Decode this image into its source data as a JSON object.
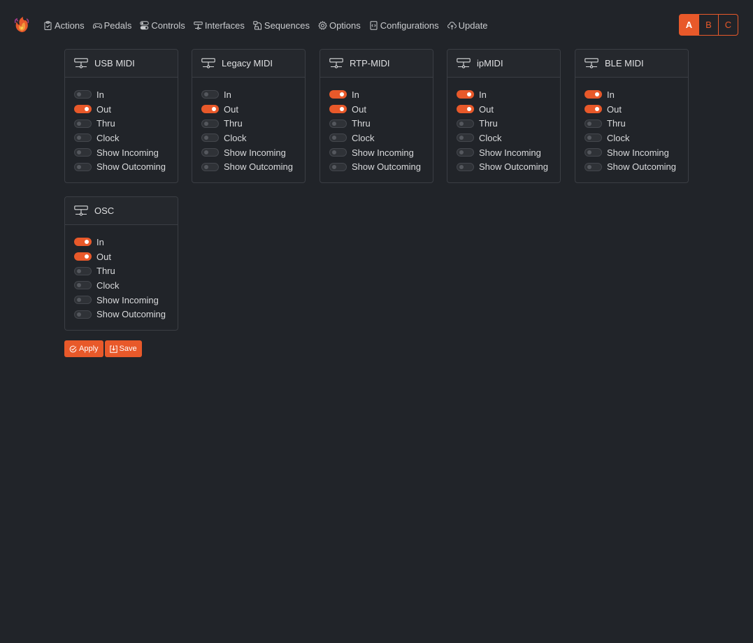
{
  "nav": {
    "items": [
      {
        "label": "Actions",
        "icon": "clipboard-icon"
      },
      {
        "label": "Pedals",
        "icon": "gamepad-icon"
      },
      {
        "label": "Controls",
        "icon": "toggles-icon"
      },
      {
        "label": "Interfaces",
        "icon": "interface-icon"
      },
      {
        "label": "Sequences",
        "icon": "sequence-icon"
      },
      {
        "label": "Options",
        "icon": "gear-icon"
      },
      {
        "label": "Configurations",
        "icon": "file-code-icon"
      },
      {
        "label": "Update",
        "icon": "cloud-upload-icon"
      }
    ]
  },
  "profiles": {
    "buttons": [
      "A",
      "B",
      "C"
    ],
    "active": "A"
  },
  "interfaces": [
    {
      "title": "USB MIDI",
      "toggles": [
        {
          "label": "In",
          "on": false
        },
        {
          "label": "Out",
          "on": true
        },
        {
          "label": "Thru",
          "on": false
        },
        {
          "label": "Clock",
          "on": false
        },
        {
          "label": "Show Incoming",
          "on": false
        },
        {
          "label": "Show Outcoming",
          "on": false
        }
      ]
    },
    {
      "title": "Legacy MIDI",
      "toggles": [
        {
          "label": "In",
          "on": false
        },
        {
          "label": "Out",
          "on": true
        },
        {
          "label": "Thru",
          "on": false
        },
        {
          "label": "Clock",
          "on": false
        },
        {
          "label": "Show Incoming",
          "on": false
        },
        {
          "label": "Show Outcoming",
          "on": false
        }
      ]
    },
    {
      "title": "RTP-MIDI",
      "toggles": [
        {
          "label": "In",
          "on": true
        },
        {
          "label": "Out",
          "on": true
        },
        {
          "label": "Thru",
          "on": false
        },
        {
          "label": "Clock",
          "on": false
        },
        {
          "label": "Show Incoming",
          "on": false
        },
        {
          "label": "Show Outcoming",
          "on": false
        }
      ]
    },
    {
      "title": "ipMIDI",
      "toggles": [
        {
          "label": "In",
          "on": true
        },
        {
          "label": "Out",
          "on": true
        },
        {
          "label": "Thru",
          "on": false
        },
        {
          "label": "Clock",
          "on": false
        },
        {
          "label": "Show Incoming",
          "on": false
        },
        {
          "label": "Show Outcoming",
          "on": false
        }
      ]
    },
    {
      "title": "BLE MIDI",
      "toggles": [
        {
          "label": "In",
          "on": true
        },
        {
          "label": "Out",
          "on": true
        },
        {
          "label": "Thru",
          "on": false
        },
        {
          "label": "Clock",
          "on": false
        },
        {
          "label": "Show Incoming",
          "on": false
        },
        {
          "label": "Show Outcoming",
          "on": false
        }
      ]
    },
    {
      "title": "OSC",
      "toggles": [
        {
          "label": "In",
          "on": true
        },
        {
          "label": "Out",
          "on": true
        },
        {
          "label": "Thru",
          "on": false
        },
        {
          "label": "Clock",
          "on": false
        },
        {
          "label": "Show Incoming",
          "on": false
        },
        {
          "label": "Show Outcoming",
          "on": false
        }
      ]
    }
  ],
  "footer": {
    "apply_label": "Apply",
    "save_label": "Save"
  },
  "colors": {
    "accent": "#e8592a",
    "background": "#212429",
    "card_border": "#3b3e44"
  }
}
